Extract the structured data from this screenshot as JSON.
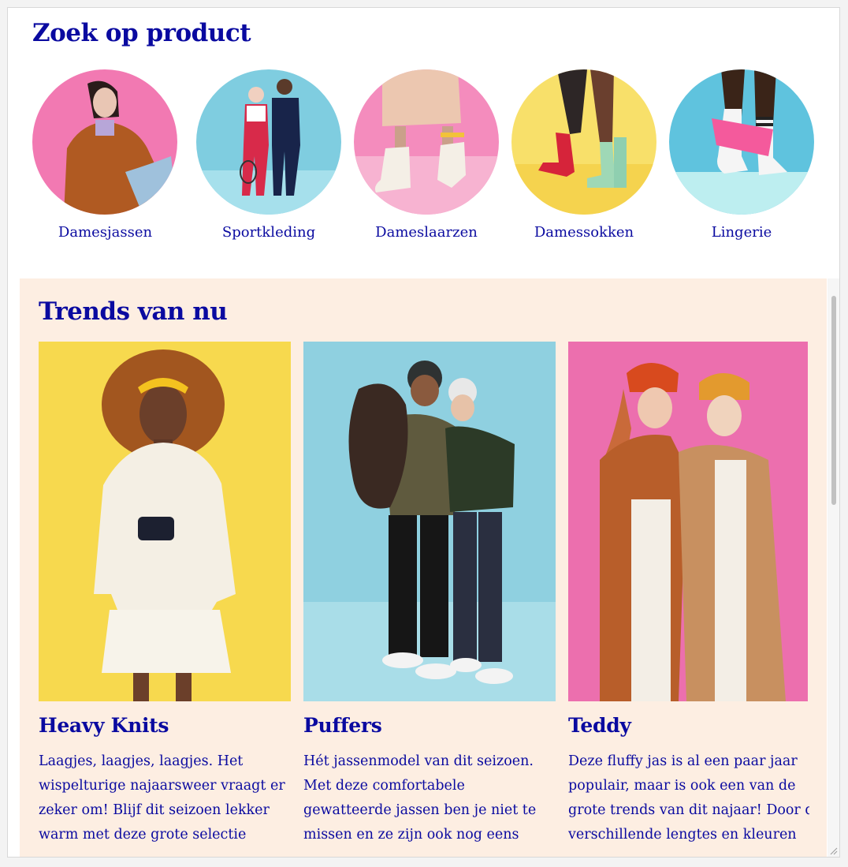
{
  "product_section": {
    "title": "Zoek op product",
    "categories": [
      {
        "label": "Damesjassen",
        "bg": "#f279b2"
      },
      {
        "label": "Sportkleding",
        "bg": "#7fcde0"
      },
      {
        "label": "Dameslaarzen",
        "bg": "#f48cbd"
      },
      {
        "label": "Damessokken",
        "bg": "#f8e06a"
      },
      {
        "label": "Lingerie",
        "bg": "#5fc3de"
      }
    ]
  },
  "trends_section": {
    "title": "Trends van nu",
    "cards": [
      {
        "title": "Heavy Knits",
        "bg": "#f7d94e",
        "lines": [
          "Laagjes, laagjes, laagjes. Het",
          "wispelturige najaarsweer vraagt er",
          "zeker om! Blijf dit seizoen lekker",
          "warm met deze grote selectie"
        ]
      },
      {
        "title": "Puffers",
        "bg": "#8fd0e0",
        "lines": [
          "Hét jassenmodel van dit seizoen.",
          "Met deze comfortabele",
          "gewatteerde jassen ben je niet te",
          "missen en ze zijn ook nog eens"
        ]
      },
      {
        "title": "Teddy",
        "bg": "#ec6fae",
        "lines": [
          "Deze fluffy jas is al een paar jaar",
          "populair, maar is ook een van de",
          "grote trends van dit najaar! Door d",
          "verschillende lengtes en kleuren"
        ]
      }
    ]
  },
  "colors": {
    "brand_blue": "#0a0aa0",
    "trends_bg": "#fdeee2"
  }
}
